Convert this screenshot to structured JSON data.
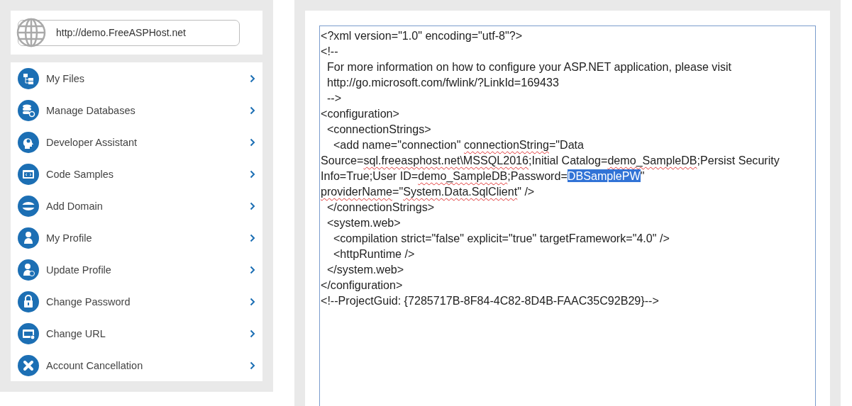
{
  "site_url": {
    "value": "http://demo.FreeASPHost.net"
  },
  "menu": [
    {
      "label": "My Files"
    },
    {
      "label": "Manage Databases"
    },
    {
      "label": "Developer Assistant"
    },
    {
      "label": "Code Samples"
    },
    {
      "label": "Add Domain"
    },
    {
      "label": "My Profile"
    },
    {
      "label": "Update Profile"
    },
    {
      "label": "Change Password"
    },
    {
      "label": "Change URL"
    },
    {
      "label": "Account Cancellation"
    }
  ],
  "editor": {
    "lines": [
      [
        {
          "text": "<?xml version=\"1.0\" encoding=\"utf-8\"?>",
          "selected": false,
          "misspelled": false
        }
      ],
      [
        {
          "text": "<!--",
          "selected": false,
          "misspelled": false
        }
      ],
      [
        {
          "text": "  For more information on how to configure your ASP.NET application, please visit",
          "selected": false,
          "misspelled": false
        }
      ],
      [
        {
          "text": "  http://go.microsoft.com/fwlink/?LinkId=169433",
          "selected": false,
          "misspelled": false
        }
      ],
      [
        {
          "text": "  -->",
          "selected": false,
          "misspelled": false
        }
      ],
      [
        {
          "text": "<configuration>",
          "selected": false,
          "misspelled": false
        }
      ],
      [
        {
          "text": "  <connectionStrings>",
          "selected": false,
          "misspelled": false
        }
      ],
      [
        {
          "text": "    <add name=\"connection\" ",
          "selected": false,
          "misspelled": false
        },
        {
          "text": "connectionString",
          "selected": false,
          "misspelled": true
        },
        {
          "text": "=\"Data",
          "selected": false,
          "misspelled": false
        }
      ],
      [
        {
          "text": "Source=",
          "selected": false,
          "misspelled": false
        },
        {
          "text": "sql.freeasphost.net\\MSSQL2016",
          "selected": false,
          "misspelled": true
        },
        {
          "text": ";Initial Catalog=",
          "selected": false,
          "misspelled": false
        },
        {
          "text": "demo_SampleDB",
          "selected": false,
          "misspelled": true
        },
        {
          "text": ";Persist Security",
          "selected": false,
          "misspelled": false
        }
      ],
      [
        {
          "text": "Info=True;User ID=",
          "selected": false,
          "misspelled": false
        },
        {
          "text": "demo_SampleDB",
          "selected": false,
          "misspelled": true
        },
        {
          "text": ";Password=",
          "selected": false,
          "misspelled": false
        },
        {
          "text": "DBSamplePW",
          "selected": true,
          "misspelled": false
        },
        {
          "text": "\"",
          "selected": false,
          "misspelled": false
        }
      ],
      [
        {
          "text": "providerName",
          "selected": false,
          "misspelled": true
        },
        {
          "text": "=\"",
          "selected": false,
          "misspelled": false
        },
        {
          "text": "System.Data.SqlClient",
          "selected": false,
          "misspelled": true
        },
        {
          "text": "\" />",
          "selected": false,
          "misspelled": false
        }
      ],
      [
        {
          "text": "  </connectionStrings>",
          "selected": false,
          "misspelled": false
        }
      ],
      [
        {
          "text": "  <system.web>",
          "selected": false,
          "misspelled": false
        }
      ],
      [
        {
          "text": "    <compilation strict=\"false\" explicit=\"true\" targetFramework=\"4.0\" />",
          "selected": false,
          "misspelled": false
        }
      ],
      [
        {
          "text": "    <httpRuntime />",
          "selected": false,
          "misspelled": false
        }
      ],
      [
        {
          "text": "  </system.web>",
          "selected": false,
          "misspelled": false
        }
      ],
      [
        {
          "text": "</configuration>",
          "selected": false,
          "misspelled": false
        }
      ],
      [
        {
          "text": "<!--ProjectGuid: {7285717B-8F84-4C82-8D4B-FAAC35C92B29}-->",
          "selected": false,
          "misspelled": false
        }
      ]
    ]
  }
}
